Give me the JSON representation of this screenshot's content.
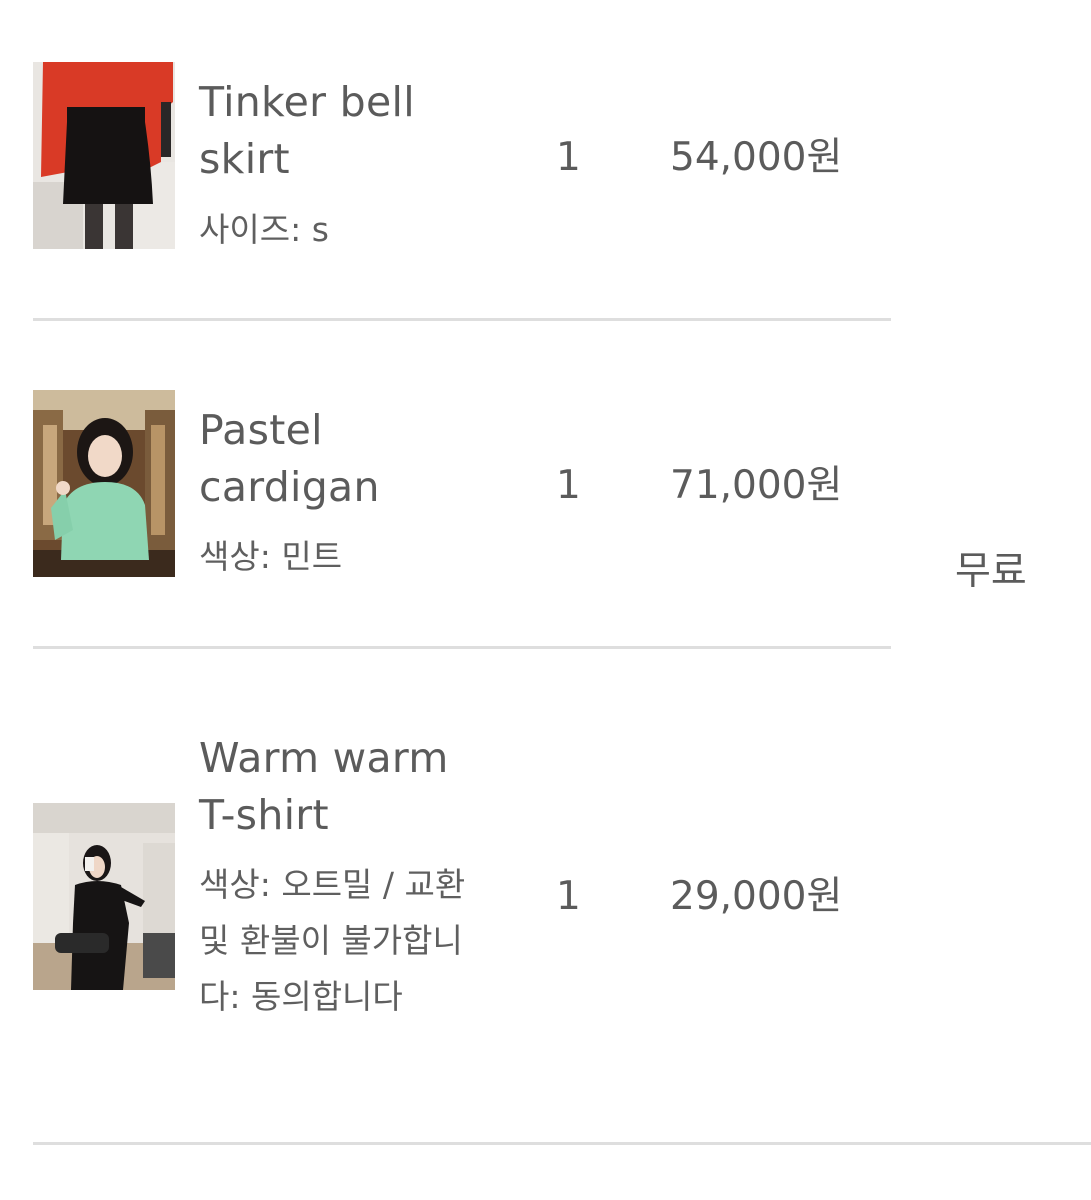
{
  "items": [
    {
      "name_line1": "Tinker bell",
      "name_line2": "skirt",
      "option": "사이즈: s",
      "quantity": "1",
      "price": "54,000원",
      "thumbnail": "photo-red-sweater-black-skirt"
    },
    {
      "name_line1": "Pastel",
      "name_line2": "cardigan",
      "option": "색상: 민트",
      "quantity": "1",
      "price": "71,000원",
      "thumbnail": "photo-mint-cardigan"
    },
    {
      "name_line1": "Warm warm",
      "name_line2": "T-shirt",
      "option": "색상: 오트밀 / 교환 및 환불이 불가합니다: 동의합니다",
      "quantity": "1",
      "price": "29,000원",
      "thumbnail": "photo-black-outfit-mirror"
    }
  ],
  "shipping": "무료",
  "colors": {
    "text": "#5b5b5b",
    "divider": "#dedede"
  }
}
